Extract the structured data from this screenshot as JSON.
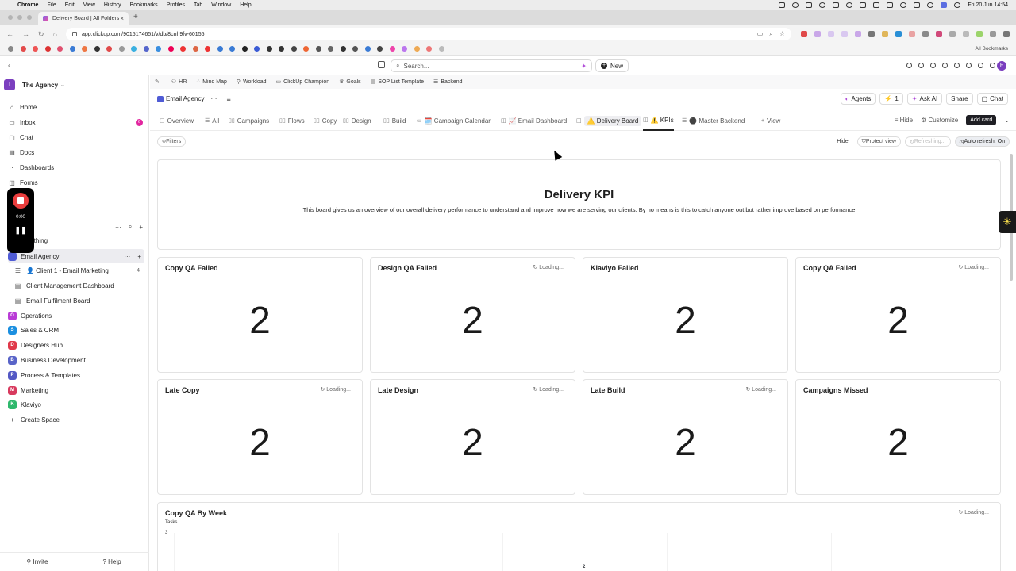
{
  "menubar": {
    "items": [
      "Chrome",
      "File",
      "Edit",
      "View",
      "History",
      "Bookmarks",
      "Profiles",
      "Tab",
      "Window",
      "Help"
    ],
    "clock": "Fri 20 Jun  14:54"
  },
  "browser": {
    "tab_title": "Delivery Board | All Folders |",
    "url": "app.clickup.com/9015174651/v/db/8cnh9fv-60155",
    "all_bookmarks": "All Bookmarks"
  },
  "topbar": {
    "search_placeholder": "Search...",
    "new_label": "New",
    "avatar_letter": "F"
  },
  "sidebar": {
    "workspace_letter": "T",
    "workspace_name": "The Agency",
    "nav": [
      {
        "label": "Home",
        "icon": "home-icon",
        "glyph": "⌂"
      },
      {
        "label": "Inbox",
        "icon": "inbox-icon",
        "glyph": "▭",
        "badge": "6"
      },
      {
        "label": "Chat",
        "icon": "chat-icon",
        "glyph": "▢"
      },
      {
        "label": "Docs",
        "icon": "docs-icon",
        "glyph": "▤"
      },
      {
        "label": "Dashboards",
        "icon": "dashboards-icon",
        "glyph": "◔"
      },
      {
        "label": "Forms",
        "icon": "forms-icon",
        "glyph": "◫"
      }
    ],
    "everything_label": "rything",
    "spaces": [
      {
        "letter": "",
        "label": "Email Agency",
        "color": "#4f5bd5"
      },
      {
        "label": "Operations",
        "letter": "O",
        "color": "#b93bd6"
      },
      {
        "label": "Sales & CRM",
        "letter": "S",
        "color": "#1b8fe0"
      },
      {
        "label": "Designers Hub",
        "letter": "D",
        "color": "#e0394a"
      },
      {
        "label": "Business Development",
        "letter": "B",
        "color": "#5964c8"
      },
      {
        "label": "Process & Templates",
        "letter": "P",
        "color": "#5358c4"
      },
      {
        "label": "Marketing",
        "letter": "M",
        "color": "#d83a5e"
      },
      {
        "label": "Klaviyo",
        "letter": "K",
        "color": "#2eb86c"
      }
    ],
    "subitems": [
      {
        "label": "👤 Client 1 - Email Marketing",
        "count": "4",
        "glyph": "☰"
      },
      {
        "label": "Client Management Dashboard",
        "glyph": "▤"
      },
      {
        "label": "Email Fulfilment Board",
        "glyph": "▤"
      }
    ],
    "create_space": "Create Space",
    "invite": "Invite",
    "help": "Help"
  },
  "recorder": {
    "time": "0:00"
  },
  "main": {
    "favorites": [
      "HR",
      "Mind Map",
      "Workload",
      "ClickUp Champion",
      "Goals",
      "SOP List Template",
      "Backend"
    ],
    "space_title": "Email Agency",
    "header_buttons": {
      "agents": "Agents",
      "count": "1",
      "ask_ai": "Ask AI",
      "share": "Share",
      "chat": "Chat"
    },
    "views": [
      {
        "label": "Overview",
        "glyph": "▢"
      },
      {
        "label": "All",
        "glyph": "☰"
      },
      {
        "label": "Campaigns",
        "glyph": "▯▯"
      },
      {
        "label": "Flows",
        "glyph": "▯▯"
      },
      {
        "label": "Copy",
        "glyph": "▯▯"
      },
      {
        "label": "Design",
        "glyph": "▯▯"
      },
      {
        "label": "Build",
        "glyph": "▯▯"
      },
      {
        "label": "🗓️ Campaign Calendar",
        "glyph": "▭"
      },
      {
        "label": "📈 Email Dashboard",
        "glyph": "◫"
      },
      {
        "label": "⚠️ Delivery Board",
        "glyph": "◫"
      },
      {
        "label": "⚠️ KPIs",
        "glyph": "◫"
      },
      {
        "label": "⚫ Master Backend",
        "glyph": "☰"
      },
      {
        "label": "View",
        "glyph": "+"
      }
    ],
    "view_right": {
      "hide": "Hide",
      "customize": "Customize",
      "add_card": "Add card"
    },
    "toolbar": {
      "filters": "Filters",
      "hide": "Hide",
      "protect": "Protect view",
      "refreshing": "Refreshing...",
      "auto_refresh": "Auto refresh: On"
    },
    "banner": {
      "title": "Delivery KPI",
      "text": "This board gives us an overview of our overall delivery performance to understand and improve how we are serving our clients. By no means is this to catch anyone out but rather improve based on performance"
    },
    "cards": [
      {
        "title": "Copy QA Failed",
        "value": "2",
        "loading": ""
      },
      {
        "title": "Design QA Failed",
        "value": "2",
        "loading": "Loading..."
      },
      {
        "title": "Klaviyo Failed",
        "value": "2",
        "loading": ""
      },
      {
        "title": "Copy QA Failed",
        "value": "2",
        "loading": "Loading..."
      },
      {
        "title": "Late Copy",
        "value": "2",
        "loading": "Loading..."
      },
      {
        "title": "Late Design",
        "value": "2",
        "loading": "Loading..."
      },
      {
        "title": "Late Build",
        "value": "2",
        "loading": "Loading..."
      },
      {
        "title": "Campaigns Missed",
        "value": "2",
        "loading": ""
      }
    ],
    "weekly": {
      "title": "Copy QA By Week",
      "loading": "Loading...",
      "ylabel": "Tasks",
      "y_top": "3",
      "bar_label": "2"
    }
  }
}
